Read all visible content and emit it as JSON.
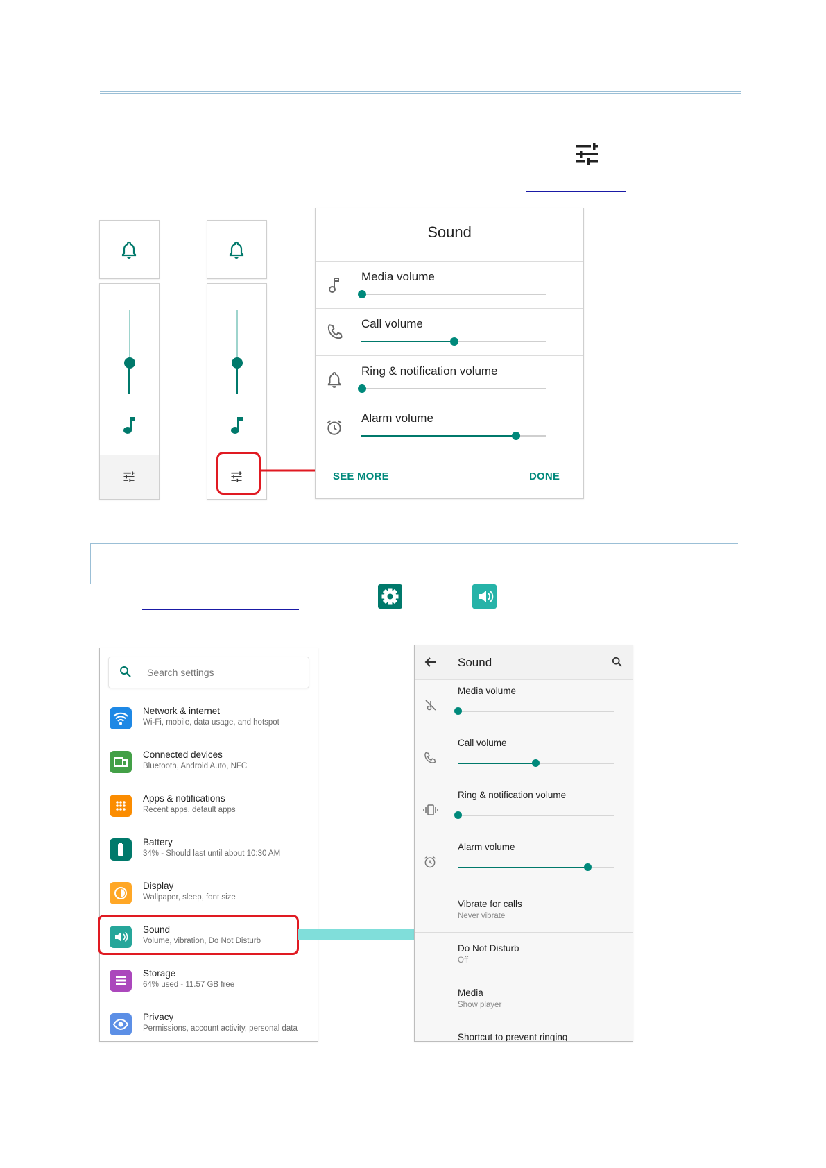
{
  "top_panel": {
    "title": "Sound",
    "rows": [
      {
        "label": "Media volume",
        "icon": "music-note-icon",
        "level": 0.0
      },
      {
        "label": "Call volume",
        "icon": "phone-icon",
        "level": 0.5
      },
      {
        "label": "Ring & notification volume",
        "icon": "bell-icon",
        "level": 0.0
      },
      {
        "label": "Alarm volume",
        "icon": "alarm-icon",
        "level": 0.84
      }
    ],
    "see_more": "SEE MORE",
    "done": "DONE"
  },
  "mini_panels": [
    {
      "top_icon": "bell-icon",
      "level": 0.33,
      "note_icon": "music-note-icon",
      "bottom_icon": "tune-icon"
    },
    {
      "top_icon": "bell-icon",
      "level": 0.33,
      "note_icon": "music-note-icon",
      "bottom_icon": "tune-icon",
      "highlighted": true
    }
  ],
  "inline_icons": [
    "tune-icon",
    "settings-gear-icon",
    "sound-speaker-icon"
  ],
  "settings_list": {
    "search_placeholder": "Search settings",
    "items": [
      {
        "title": "Network & internet",
        "subtitle": "Wi-Fi, mobile, data usage, and hotspot",
        "color": "#1e88e5",
        "icon": "wifi-icon"
      },
      {
        "title": "Connected devices",
        "subtitle": "Bluetooth, Android Auto, NFC",
        "color": "#43a047",
        "icon": "devices-icon"
      },
      {
        "title": "Apps & notifications",
        "subtitle": "Recent apps, default apps",
        "color": "#fb8c00",
        "icon": "apps-icon"
      },
      {
        "title": "Battery",
        "subtitle": "34% - Should last until about 10:30 AM",
        "color": "#00796b",
        "icon": "battery-icon"
      },
      {
        "title": "Display",
        "subtitle": "Wallpaper, sleep, font size",
        "color": "#ffa726",
        "icon": "brightness-icon"
      },
      {
        "title": "Sound",
        "subtitle": "Volume, vibration, Do Not Disturb",
        "color": "#26a69a",
        "icon": "speaker-icon",
        "highlighted": true
      },
      {
        "title": "Storage",
        "subtitle": "64% used - 11.57 GB free",
        "color": "#ab47bc",
        "icon": "storage-icon"
      },
      {
        "title": "Privacy",
        "subtitle": "Permissions, account activity, personal data",
        "color": "#5c8fe6",
        "icon": "privacy-eye-icon"
      }
    ]
  },
  "sound_screen": {
    "title": "Sound",
    "volumes": [
      {
        "label": "Media volume",
        "icon": "music-off-icon",
        "level": 0.0
      },
      {
        "label": "Call volume",
        "icon": "phone-icon",
        "level": 0.5
      },
      {
        "label": "Ring & notification volume",
        "icon": "vibrate-icon",
        "level": 0.0
      },
      {
        "label": "Alarm volume",
        "icon": "alarm-icon",
        "level": 0.83
      }
    ],
    "options": [
      {
        "label": "Vibrate for calls",
        "value": "Never vibrate"
      },
      {
        "label": "Do Not Disturb",
        "value": "Off"
      },
      {
        "label": "Media",
        "value": "Show player"
      }
    ],
    "cut_off_label": "Shortcut to prevent ringing"
  },
  "colors": {
    "accent": "#00897b",
    "highlight": "#e01a22",
    "arrow": "#80deda",
    "link": "#1a1aa6"
  }
}
